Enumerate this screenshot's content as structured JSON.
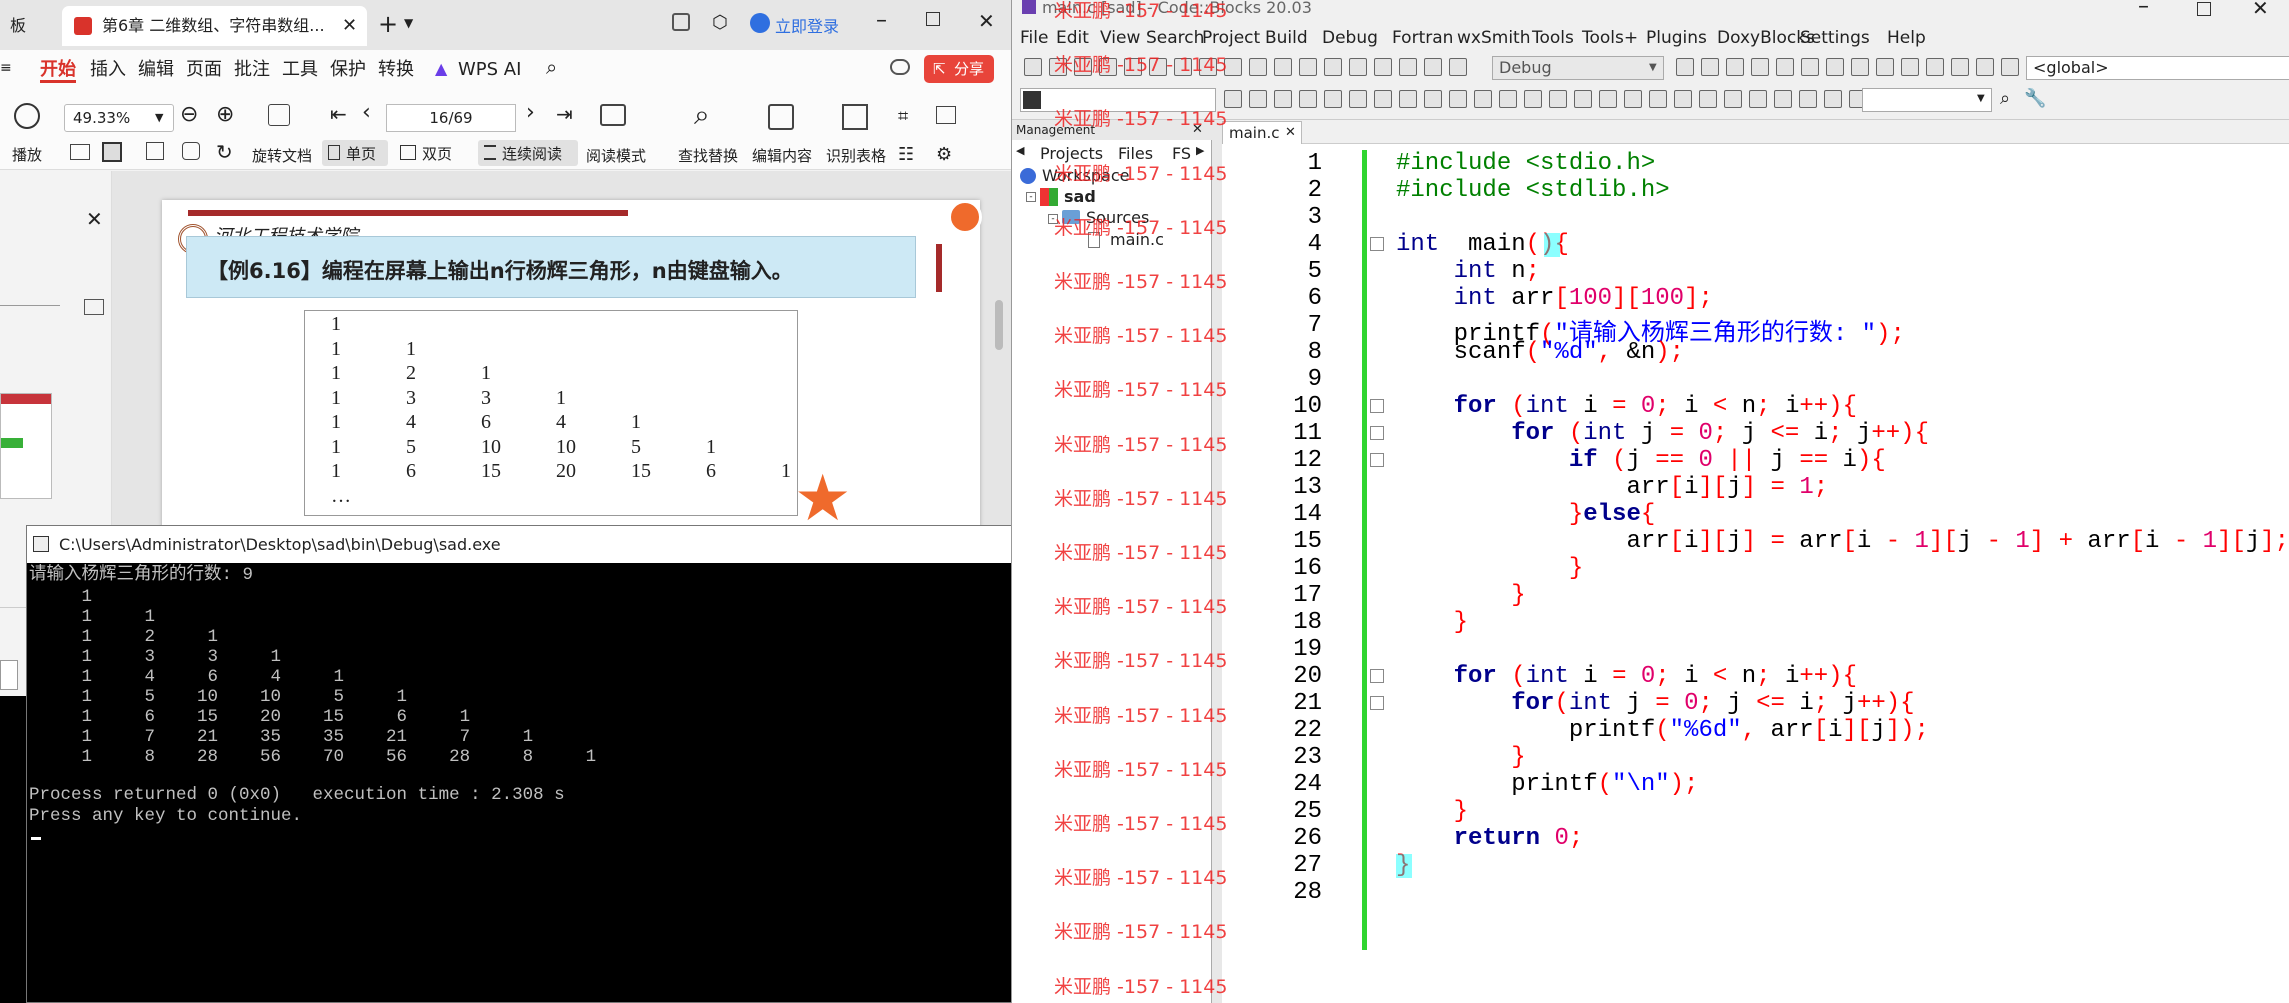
{
  "wps": {
    "tabs": [
      {
        "label": "板"
      },
      {
        "label": "第6章 二维数组、字符串数组..."
      }
    ],
    "login": "立即登录",
    "menu": [
      "开始",
      "插入",
      "编辑",
      "页面",
      "批注",
      "工具",
      "保护",
      "转换",
      "WPS AI"
    ],
    "share": "分享",
    "zoom": "49.33%",
    "page": "16/69",
    "toolbar": {
      "play": "播放",
      "rotate": "旋转文档",
      "single": "单页",
      "double": "双页",
      "continuous": "连续阅读",
      "reading": "阅读模式",
      "find": "查找替换",
      "edit": "编辑内容",
      "table": "识别表格"
    },
    "doc": {
      "school": "河北工程技术学院",
      "example": "【例6.16】编程在屏幕上输出n行杨辉三角形，n由键盘输入。",
      "triangle": [
        [
          "1"
        ],
        [
          "1",
          "1"
        ],
        [
          "1",
          "2",
          "1"
        ],
        [
          "1",
          "3",
          "3",
          "1"
        ],
        [
          "1",
          "4",
          "6",
          "4",
          "1"
        ],
        [
          "1",
          "5",
          "10",
          "10",
          "5",
          "1"
        ],
        [
          "1",
          "6",
          "15",
          "20",
          "15",
          "6",
          "1"
        ]
      ],
      "ellipsis": "…"
    }
  },
  "console": {
    "title": "C:\\Users\\Administrator\\Desktop\\sad\\bin\\Debug\\sad.exe",
    "prompt": "请输入杨辉三角形的行数: 9",
    "rows": [
      "     1",
      "     1     1",
      "     1     2     1",
      "     1     3     3     1",
      "     1     4     6     4     1",
      "     1     5    10    10     5     1",
      "     1     6    15    20    15     6     1",
      "     1     7    21    35    35    21     7     1",
      "     1     8    28    56    70    56    28     8     1"
    ],
    "status": "Process returned 0 (0x0)   execution time : 2.308 s",
    "continue": "Press any key to continue."
  },
  "codeblocks": {
    "title": "main.c [sad] - Code::Blocks 20.03",
    "menu": [
      "File",
      "Edit",
      "View",
      "Search",
      "Project",
      "Build",
      "Debug",
      "Fortran",
      "wxSmith",
      "Tools",
      "Tools+",
      "Plugins",
      "DoxyBlocks",
      "Settings",
      "Help"
    ],
    "build_target": "Debug",
    "scope": "<global>",
    "management": {
      "title": "Management",
      "tabs": [
        "Projects",
        "Files",
        "FS"
      ],
      "workspace": "Workspace",
      "project": "sad",
      "sources": "Sources",
      "file": "main.c"
    },
    "editor_tab": "main.c",
    "watermark": "米亚鹏 -157 - 1145",
    "lines": [
      [
        [
          "pp",
          "#include <stdio.h>"
        ]
      ],
      [
        [
          "pp",
          "#include <stdlib.h>"
        ]
      ],
      [],
      [
        [
          "ty",
          "int"
        ],
        [
          "",
          "  main"
        ],
        [
          "op",
          "()"
        ],
        [
          "op",
          "{"
        ]
      ],
      [
        [
          "",
          "    "
        ],
        [
          "ty",
          "int"
        ],
        [
          "",
          "",
          " n"
        ],
        [
          "op",
          ";"
        ]
      ],
      [
        [
          "",
          "    "
        ],
        [
          "ty",
          "int"
        ],
        [
          "",
          "",
          " arr"
        ],
        [
          "op",
          "["
        ],
        [
          "num",
          "100"
        ],
        [
          "op",
          "]["
        ],
        [
          "num",
          "100"
        ],
        [
          "op",
          "];"
        ]
      ],
      [
        [
          "",
          "    printf"
        ],
        [
          "op",
          "("
        ],
        [
          "str",
          "\"请输入杨辉三角形的行数: \""
        ],
        [
          "op",
          ");"
        ]
      ],
      [
        [
          "",
          "    scanf"
        ],
        [
          "op",
          "("
        ],
        [
          "str",
          "\"%d\""
        ],
        [
          "op",
          ","
        ],
        [
          "",
          " &n"
        ],
        [
          "op",
          ");"
        ]
      ],
      [],
      [
        [
          "",
          "    "
        ],
        [
          "kw",
          "for"
        ],
        [
          "",
          "",
          " "
        ],
        [
          "op",
          "("
        ],
        [
          "ty",
          "int"
        ],
        [
          "",
          " i "
        ],
        [
          "op",
          "="
        ],
        [
          "",
          " "
        ],
        [
          "num",
          "0"
        ],
        [
          "op",
          ";"
        ],
        [
          "",
          " i "
        ],
        [
          "op",
          "<"
        ],
        [
          "",
          " n"
        ],
        [
          "op",
          ";"
        ],
        [
          "",
          " i"
        ],
        [
          "op",
          "++){"
        ]
      ],
      [
        [
          "",
          "        "
        ],
        [
          "kw",
          "for"
        ],
        [
          "",
          " "
        ],
        [
          "op",
          "("
        ],
        [
          "ty",
          "int"
        ],
        [
          "",
          " j "
        ],
        [
          "op",
          "="
        ],
        [
          "",
          " "
        ],
        [
          "num",
          "0"
        ],
        [
          "op",
          ";"
        ],
        [
          "",
          " j "
        ],
        [
          "op",
          "<="
        ],
        [
          "",
          " i"
        ],
        [
          "op",
          ";"
        ],
        [
          "",
          " j"
        ],
        [
          "op",
          "++){"
        ]
      ],
      [
        [
          "",
          "            "
        ],
        [
          "kw",
          "if"
        ],
        [
          "",
          " "
        ],
        [
          "op",
          "("
        ],
        [
          "",
          "j "
        ],
        [
          "op",
          "=="
        ],
        [
          "",
          " "
        ],
        [
          "num",
          "0"
        ],
        [
          "",
          " "
        ],
        [
          "op",
          "||"
        ],
        [
          "",
          " j "
        ],
        [
          "op",
          "=="
        ],
        [
          "",
          " i"
        ],
        [
          "op",
          ")"
        ],
        [
          "op",
          "{"
        ]
      ],
      [
        [
          "",
          "                arr"
        ],
        [
          "op",
          "["
        ],
        [
          "",
          "i"
        ],
        [
          "op",
          "]["
        ],
        [
          "",
          "j"
        ],
        [
          "op",
          "]"
        ],
        [
          "",
          " "
        ],
        [
          "op",
          "="
        ],
        [
          "",
          " "
        ],
        [
          "num",
          "1"
        ],
        [
          "op",
          ";"
        ]
      ],
      [
        [
          "",
          "            "
        ],
        [
          "op",
          "}"
        ],
        [
          "kw",
          "else"
        ],
        [
          "op",
          "{"
        ]
      ],
      [
        [
          "",
          "                arr"
        ],
        [
          "op",
          "["
        ],
        [
          "",
          "i"
        ],
        [
          "op",
          "]["
        ],
        [
          "",
          "j"
        ],
        [
          "op",
          "]"
        ],
        [
          "",
          " "
        ],
        [
          "op",
          "="
        ],
        [
          "",
          " arr"
        ],
        [
          "op",
          "["
        ],
        [
          "",
          "i "
        ],
        [
          "op",
          "-"
        ],
        [
          "",
          " "
        ],
        [
          "num",
          "1"
        ],
        [
          "op",
          "]["
        ],
        [
          "",
          "j "
        ],
        [
          "op",
          "-"
        ],
        [
          "",
          " "
        ],
        [
          "num",
          "1"
        ],
        [
          "op",
          "]"
        ],
        [
          "",
          " "
        ],
        [
          "op",
          "+"
        ],
        [
          "",
          " arr"
        ],
        [
          "op",
          "["
        ],
        [
          "",
          "i "
        ],
        [
          "op",
          "-"
        ],
        [
          "",
          " "
        ],
        [
          "num",
          "1"
        ],
        [
          "op",
          "]["
        ],
        [
          "",
          "j"
        ],
        [
          "op",
          "];"
        ]
      ],
      [
        [
          "",
          "            "
        ],
        [
          "op",
          "}"
        ]
      ],
      [
        [
          "",
          "        "
        ],
        [
          "op",
          "}"
        ]
      ],
      [
        [
          "",
          "    "
        ],
        [
          "op",
          "}"
        ]
      ],
      [],
      [
        [
          "",
          "    "
        ],
        [
          "kw",
          "for"
        ],
        [
          "",
          " "
        ],
        [
          "op",
          "("
        ],
        [
          "ty",
          "int"
        ],
        [
          "",
          " i "
        ],
        [
          "op",
          "="
        ],
        [
          "",
          " "
        ],
        [
          "num",
          "0"
        ],
        [
          "op",
          ";"
        ],
        [
          "",
          " i "
        ],
        [
          "op",
          "<"
        ],
        [
          "",
          " n"
        ],
        [
          "op",
          ";"
        ],
        [
          "",
          " i"
        ],
        [
          "op",
          "++){"
        ]
      ],
      [
        [
          "",
          "        "
        ],
        [
          "kw",
          "for"
        ],
        [
          "op",
          "("
        ],
        [
          "ty",
          "int"
        ],
        [
          "",
          " j "
        ],
        [
          "op",
          "="
        ],
        [
          "",
          " "
        ],
        [
          "num",
          "0"
        ],
        [
          "op",
          ";"
        ],
        [
          "",
          " j "
        ],
        [
          "op",
          "<="
        ],
        [
          "",
          " i"
        ],
        [
          "op",
          ";"
        ],
        [
          "",
          " j"
        ],
        [
          "op",
          "++){"
        ]
      ],
      [
        [
          "",
          "            printf"
        ],
        [
          "op",
          "("
        ],
        [
          "str",
          "\"%6d\""
        ],
        [
          "op",
          ","
        ],
        [
          "",
          " arr"
        ],
        [
          "op",
          "["
        ],
        [
          "",
          "i"
        ],
        [
          "op",
          "]["
        ],
        [
          "",
          "j"
        ],
        [
          "op",
          "]);"
        ]
      ],
      [
        [
          "",
          "        "
        ],
        [
          "op",
          "}"
        ]
      ],
      [
        [
          "",
          "        printf"
        ],
        [
          "op",
          "("
        ],
        [
          "str",
          "\"\\n\""
        ],
        [
          "op",
          ");"
        ]
      ],
      [
        [
          "",
          "    "
        ],
        [
          "op",
          "}"
        ]
      ],
      [
        [
          "",
          "    "
        ],
        [
          "kw",
          "return"
        ],
        [
          "",
          " "
        ],
        [
          "num",
          "0"
        ],
        [
          "op",
          ";"
        ]
      ],
      [
        [
          "op",
          "}"
        ]
      ],
      []
    ]
  }
}
